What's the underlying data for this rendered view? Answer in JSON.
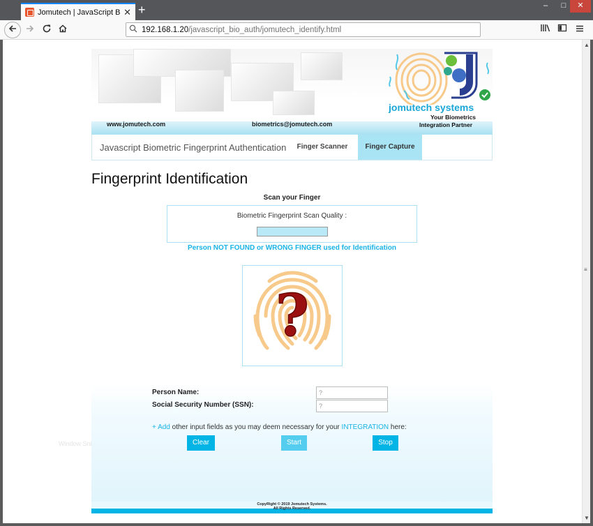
{
  "browser": {
    "tab_title": "Jomutech | JavaScript Biometric",
    "tab_close": "✕",
    "new_tab": "+",
    "url_host": "192.168.1.20",
    "url_path": "/javascript_bio_auth/jomutech_identify.html",
    "window_controls": {
      "minimize": "–",
      "maximize": "□",
      "close": "✕"
    },
    "icons": [
      "back-icon",
      "forward-icon",
      "reload-icon",
      "home-icon",
      "search-icon",
      "library-icon",
      "sidebar-icon",
      "menu-icon"
    ]
  },
  "banner": {
    "website": "www.jomutech.com",
    "email": "biometrics@jomutech.com",
    "brand": "jomutech systems",
    "tagline_1": "Your Biometrics",
    "tagline_2": "Integration Partner"
  },
  "site_nav": {
    "brand": "Javascript Biometric Fingerprint Authentication",
    "items": [
      {
        "label": "Finger Scanner",
        "active": false
      },
      {
        "label": "Finger Capture",
        "active": true
      }
    ]
  },
  "main": {
    "page_title": "Fingerprint Identification",
    "scan_title": "Scan your Finger",
    "quality_label": "Biometric Fingerprint Scan Quality :",
    "quality_level": 1.0,
    "status_message": "Person NOT FOUND or WRONG FINGER used for Identification",
    "fingerprint_result": "?"
  },
  "form": {
    "name_label": "Person Name:",
    "name_value": "?",
    "ssn_label": "Social Security Number (SSN):",
    "ssn_value": "?",
    "note_add": "+ Add",
    "note_mid": " other input fields as you may deem necessary for your ",
    "note_integration": "INTEGRATION",
    "note_end": " here:",
    "buttons": {
      "clear": "Clear",
      "start": "Start",
      "stop": "Stop"
    }
  },
  "footer": {
    "copyright": "CopyRight © 2019 Jomutech Systems.",
    "rights": "All Rights Reserved."
  },
  "overlay": {
    "ghost_text": "Window Snip"
  },
  "colors": {
    "accent": "#00b4e6",
    "accent_light": "#a9e4f5",
    "status_text": "#19b3e6",
    "fingerprint_ridges": "#f7c98a",
    "question_mark": "#9b1010"
  }
}
